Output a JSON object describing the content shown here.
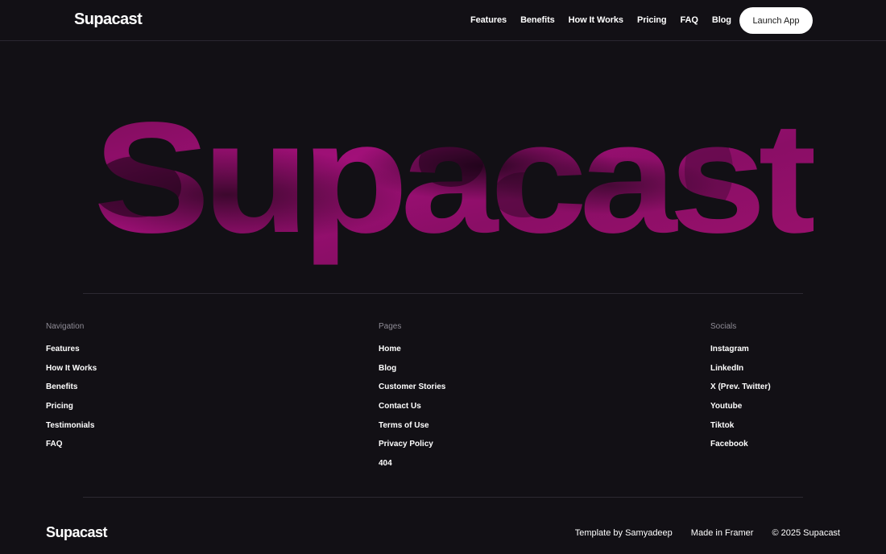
{
  "header": {
    "logo": "Supacast",
    "nav": [
      "Features",
      "Benefits",
      "How It Works",
      "Pricing",
      "FAQ",
      "Blog"
    ],
    "cta": "Launch App"
  },
  "hero": {
    "wordmark": "Supacast",
    "accent_color": "#9b0f6e",
    "shadow_color": "#3a0a2c"
  },
  "footer": {
    "columns": [
      {
        "title": "Navigation",
        "links": [
          "Features",
          "How It Works",
          "Benefits",
          "Pricing",
          "Testimonials",
          "FAQ"
        ]
      },
      {
        "title": "Pages",
        "links": [
          "Home",
          "Blog",
          "Customer Stories",
          "Contact Us",
          "Terms of Use",
          "Privacy Policy",
          "404"
        ]
      },
      {
        "title": "Socials",
        "links": [
          "Instagram",
          "LinkedIn",
          "X (Prev. Twitter)",
          "Youtube",
          "Tiktok",
          "Facebook"
        ]
      }
    ],
    "logo": "Supacast",
    "credits": [
      "Template by Samyadeep",
      "Made in Framer",
      "© 2025 Supacast"
    ]
  }
}
